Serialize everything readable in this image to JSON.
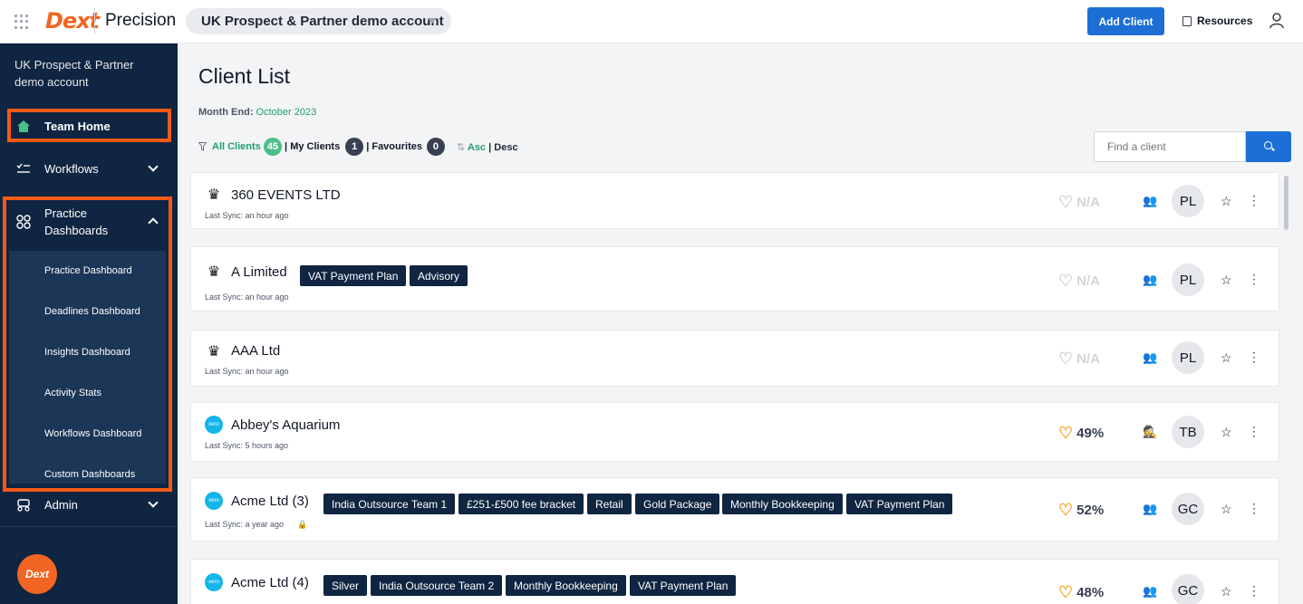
{
  "topbar": {
    "logo": "Dext",
    "product": "Precision",
    "account": "UK Prospect & Partner demo account",
    "add_client": "Add Client",
    "resources": "Resources"
  },
  "sidebar": {
    "account_name": "UK Prospect & Partner demo account",
    "team_home": "Team Home",
    "workflows": "Workflows",
    "practice_dashboards": "Practice Dashboards",
    "sub_items": [
      "Practice Dashboard",
      "Deadlines Dashboard",
      "Insights Dashboard",
      "Activity Stats",
      "Workflows Dashboard",
      "Custom Dashboards"
    ],
    "admin": "Admin",
    "fab": "Dext",
    "highlight_color": "#f55a14"
  },
  "main": {
    "title": "Client List",
    "month_end_label": "Month End:",
    "month_end_value": "October 2023",
    "filters": {
      "all_clients": "All Clients",
      "all_count": "45",
      "my_clients": "My Clients",
      "my_count": "1",
      "favourites": "Favourites",
      "fav_count": "0",
      "asc": "Asc",
      "desc": "Desc"
    },
    "search_placeholder": "Find a client"
  },
  "clients": [
    {
      "name": "360 EVENTS LTD",
      "source": "hmrc-icon",
      "sync": "Last Sync: an hour ago",
      "tags": [],
      "health": "N/A",
      "owner": "PL"
    },
    {
      "name": "A Limited",
      "source": "hmrc-icon",
      "sync": "Last Sync: an hour ago",
      "tags": [
        "VAT Payment Plan",
        "Advisory"
      ],
      "health": "N/A",
      "owner": "PL"
    },
    {
      "name": "AAA Ltd",
      "source": "hmrc-icon",
      "sync": "Last Sync: an hour ago",
      "tags": [],
      "health": "N/A",
      "owner": "PL"
    },
    {
      "name": "Abbey's Aquarium",
      "source": "xero-icon",
      "sync": "Last Sync: 5 hours ago",
      "tags": [],
      "health": "49%",
      "owner": "TB"
    },
    {
      "name": "Acme Ltd (3)",
      "source": "xero-icon",
      "sync": "Last Sync: a year ago",
      "tags": [
        "India Outsource Team 1",
        "£251-£500 fee bracket",
        "Retail",
        "Gold Package",
        "Monthly Bookkeeping",
        "VAT Payment Plan"
      ],
      "health": "52%",
      "owner": "GC"
    },
    {
      "name": "Acme Ltd (4)",
      "source": "xero-icon",
      "sync": "",
      "tags": [
        "Silver",
        "India Outsource Team 2",
        "Monthly Bookkeeping",
        "VAT Payment Plan"
      ],
      "health": "48%",
      "owner": "GC"
    }
  ],
  "xero_badge": "xero",
  "colors": {
    "brand_orange": "#f26522",
    "primary_blue": "#1d6fd6",
    "nav_bg": "#0f2541",
    "green": "#22a06b",
    "heart_amber": "#f5a524"
  }
}
